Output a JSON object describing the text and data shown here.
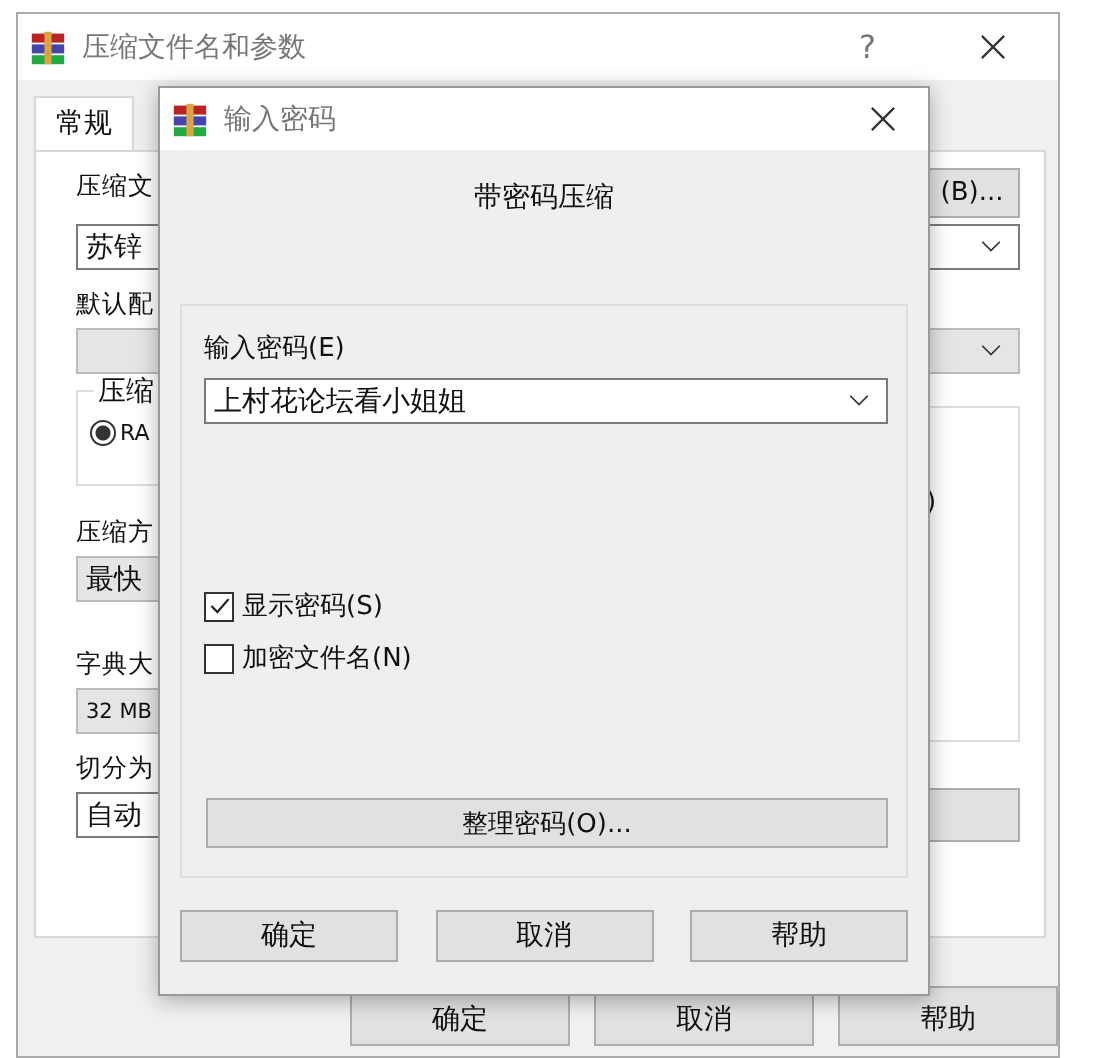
{
  "main_window": {
    "title": "压缩文件名和参数",
    "help_button": "?",
    "tabs": [
      {
        "label": "常规",
        "selected": true
      }
    ],
    "archive_name": {
      "label": "压缩文",
      "value": "苏锌",
      "browse_button": "(B)..."
    },
    "profile": {
      "label": "默认配"
    },
    "format_group": {
      "label": "压缩",
      "options": [
        {
          "label": "RA",
          "selected": true
        }
      ]
    },
    "right_group_fragment": ")",
    "method": {
      "label": "压缩方",
      "value": "最快"
    },
    "dictionary": {
      "label": "字典大",
      "value": "32 MB"
    },
    "split": {
      "label": "切分为",
      "value": "自动"
    },
    "buttons": [
      "确定",
      "取消",
      "帮助"
    ]
  },
  "password_dialog": {
    "title": "输入密码",
    "heading": "带密码压缩",
    "password": {
      "label": "输入密码(E)",
      "value": "上村花论坛看小姐姐"
    },
    "options": [
      {
        "label": "显示密码(S)",
        "checked": true
      },
      {
        "label": "加密文件名(N)",
        "checked": false
      }
    ],
    "organize_button": "整理密码(O)...",
    "buttons": [
      "确定",
      "取消",
      "帮助"
    ]
  }
}
